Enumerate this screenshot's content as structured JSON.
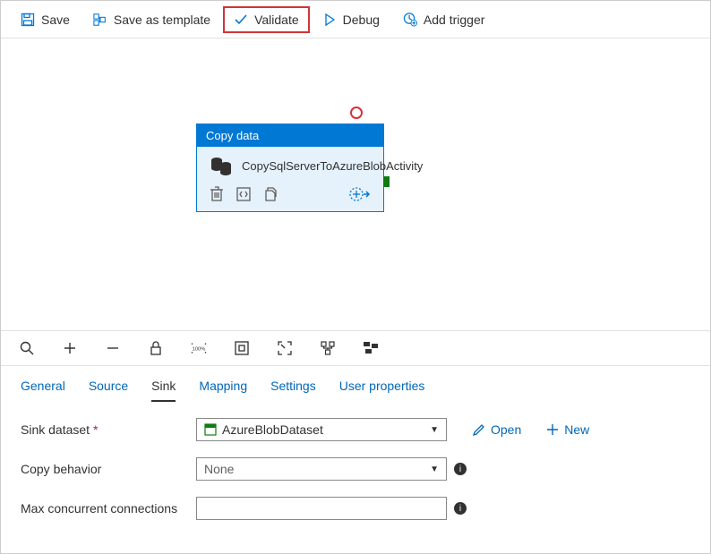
{
  "toolbar": {
    "save": "Save",
    "saveAsTemplate": "Save as template",
    "validate": "Validate",
    "debug": "Debug",
    "addTrigger": "Add trigger"
  },
  "node": {
    "header": "Copy data",
    "name": "CopySqlServerToAzureBlobActivity"
  },
  "tabs": {
    "general": "General",
    "source": "Source",
    "sink": "Sink",
    "mapping": "Mapping",
    "settings": "Settings",
    "userProperties": "User properties"
  },
  "form": {
    "sinkDatasetLabel": "Sink dataset",
    "sinkDatasetValue": "AzureBlobDataset",
    "openLabel": "Open",
    "newLabel": "New",
    "copyBehaviorLabel": "Copy behavior",
    "copyBehaviorValue": "None",
    "maxConcurrentLabel": "Max concurrent connections",
    "maxConcurrentValue": ""
  }
}
